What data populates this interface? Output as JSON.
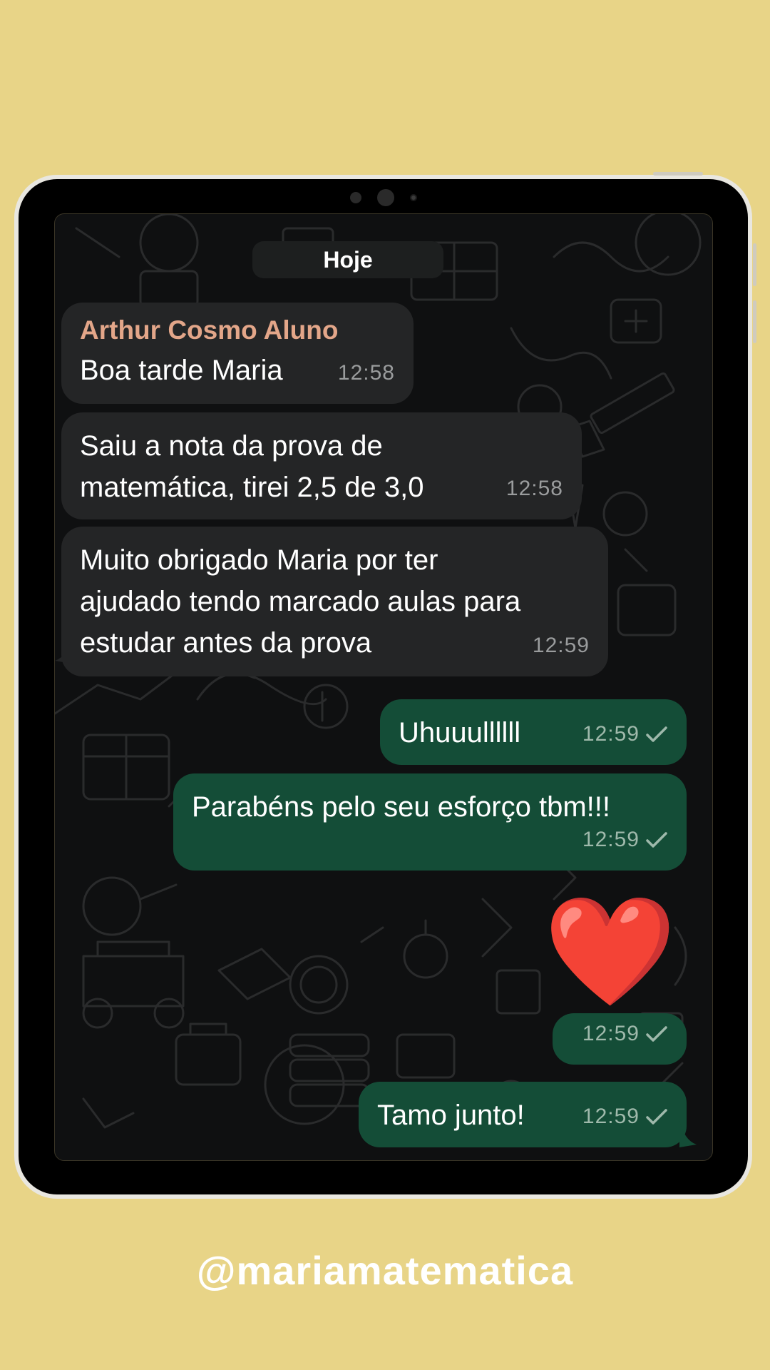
{
  "chat": {
    "day_label": "Hoje",
    "messages": [
      {
        "direction": "incoming",
        "sender": "Arthur Cosmo Aluno",
        "text": "Boa tarde Maria",
        "time": "12:58"
      },
      {
        "direction": "incoming",
        "text_lines": [
          "Saiu a nota da prova de",
          "matemática, tirei 2,5 de 3,0"
        ],
        "time": "12:58"
      },
      {
        "direction": "incoming",
        "text_lines": [
          "Muito obrigado Maria por ter",
          "ajudado tendo marcado aulas para",
          "estudar antes da prova"
        ],
        "time": "12:59"
      },
      {
        "direction": "outgoing",
        "text": "Uhuuullllll",
        "time": "12:59",
        "status": "sent-check-icon"
      },
      {
        "direction": "outgoing",
        "text": "Parabéns pelo seu esforço tbm!!!",
        "time": "12:59",
        "status": "sent-check-icon"
      },
      {
        "direction": "outgoing",
        "emoji": "❤️",
        "time": "12:59",
        "status": "sent-check-icon"
      },
      {
        "direction": "outgoing",
        "text": "Tamo junto!",
        "time": "12:59",
        "status": "sent-check-icon"
      }
    ]
  },
  "footer": {
    "handle": "@mariamatematica"
  },
  "colors": {
    "background": "#e8d487",
    "incoming_bubble": "#242526",
    "outgoing_bubble": "#144d37",
    "sender_name": "#e3a689"
  }
}
